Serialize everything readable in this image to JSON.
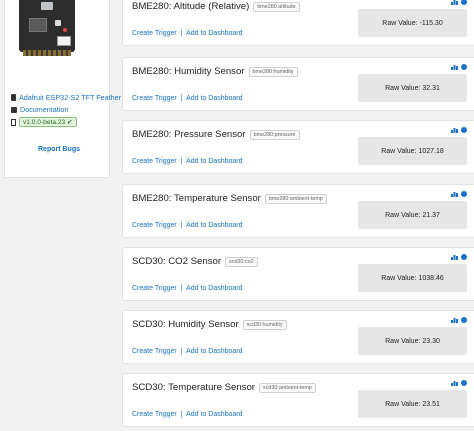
{
  "sidebar": {
    "board_name": "Adafruit ESP32-S2 TFT Feather",
    "documentation_label": "Documentation",
    "version": "v1.0.0-beta.23 ✔",
    "report_bugs_label": "Report Bugs"
  },
  "feeds": [
    {
      "name": "BME280: Altitude (Relative)",
      "key": "bme280:altitude",
      "links": {
        "trigger": "Create Trigger",
        "separator": "|",
        "dashboard": "Add to Dashboard"
      },
      "raw_value": "Raw Value: -115.30"
    },
    {
      "name": "BME280: Humidity Sensor",
      "key": "bme280:humidity",
      "links": {
        "trigger": "Create Trigger",
        "separator": "|",
        "dashboard": "Add to Dashboard"
      },
      "raw_value": "Raw Value: 32.31"
    },
    {
      "name": "BME280: Pressure Sensor",
      "key": "bme280:pressure",
      "links": {
        "trigger": "Create Trigger",
        "separator": "|",
        "dashboard": "Add to Dashboard"
      },
      "raw_value": "Raw Value: 1027.18"
    },
    {
      "name": "BME280: Temperature Sensor",
      "key": "bme280:ambient-temp",
      "links": {
        "trigger": "Create Trigger",
        "separator": "|",
        "dashboard": "Add to Dashboard"
      },
      "raw_value": "Raw Value: 21.37"
    },
    {
      "name": "SCD30: CO2 Sensor",
      "key": "scd30:co2",
      "links": {
        "trigger": "Create Trigger",
        "separator": "|",
        "dashboard": "Add to Dashboard"
      },
      "raw_value": "Raw Value: 1038.46"
    },
    {
      "name": "SCD30: Humidity Sensor",
      "key": "scd30:humidity",
      "links": {
        "trigger": "Create Trigger",
        "separator": "|",
        "dashboard": "Add to Dashboard"
      },
      "raw_value": "Raw Value: 23.30"
    },
    {
      "name": "SCD30: Temperature Sensor",
      "key": "scd30:ambient-temp",
      "links": {
        "trigger": "Create Trigger",
        "separator": "|",
        "dashboard": "Add to Dashboard"
      },
      "raw_value": "Raw Value: 23.51"
    }
  ],
  "colors": {
    "link": "#1a73c9",
    "accent": "#1a73c9",
    "badge_green": "#2b6b2b"
  },
  "icons": {
    "chart": "bar-chart-icon",
    "settings": "gear-icon"
  }
}
